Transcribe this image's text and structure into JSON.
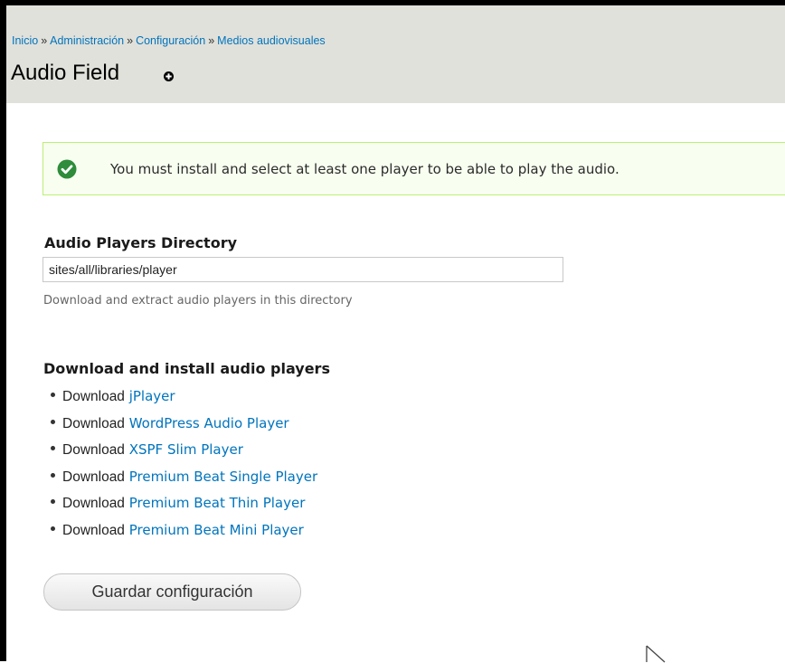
{
  "breadcrumb": {
    "items": [
      "Inicio",
      "Administración",
      "Configuración",
      "Medios audiovisuales"
    ],
    "separator": "»"
  },
  "page": {
    "title": "Audio Field",
    "shortcut_icon": "plus-circle-icon"
  },
  "message": {
    "icon": "check-circle-icon",
    "text": "You must install and select at least one player to be able to play the audio."
  },
  "directory_field": {
    "label": "Audio Players Directory",
    "value": "sites/all/libraries/player",
    "description": "Download and extract audio players in this directory"
  },
  "download_section": {
    "title": "Download and install audio players",
    "prefix": "Download",
    "players": [
      "jPlayer",
      "WordPress Audio Player",
      "XSPF Slim Player",
      "Premium Beat Single Player",
      "Premium Beat Thin Player",
      "Premium Beat Mini Player"
    ]
  },
  "actions": {
    "save_label": "Guardar configuración"
  },
  "colors": {
    "link": "#0074bd",
    "header_bg": "#e1e1db",
    "message_bg": "#f8fff0",
    "message_border": "#bbee77",
    "check_green": "#2e8c3a"
  }
}
